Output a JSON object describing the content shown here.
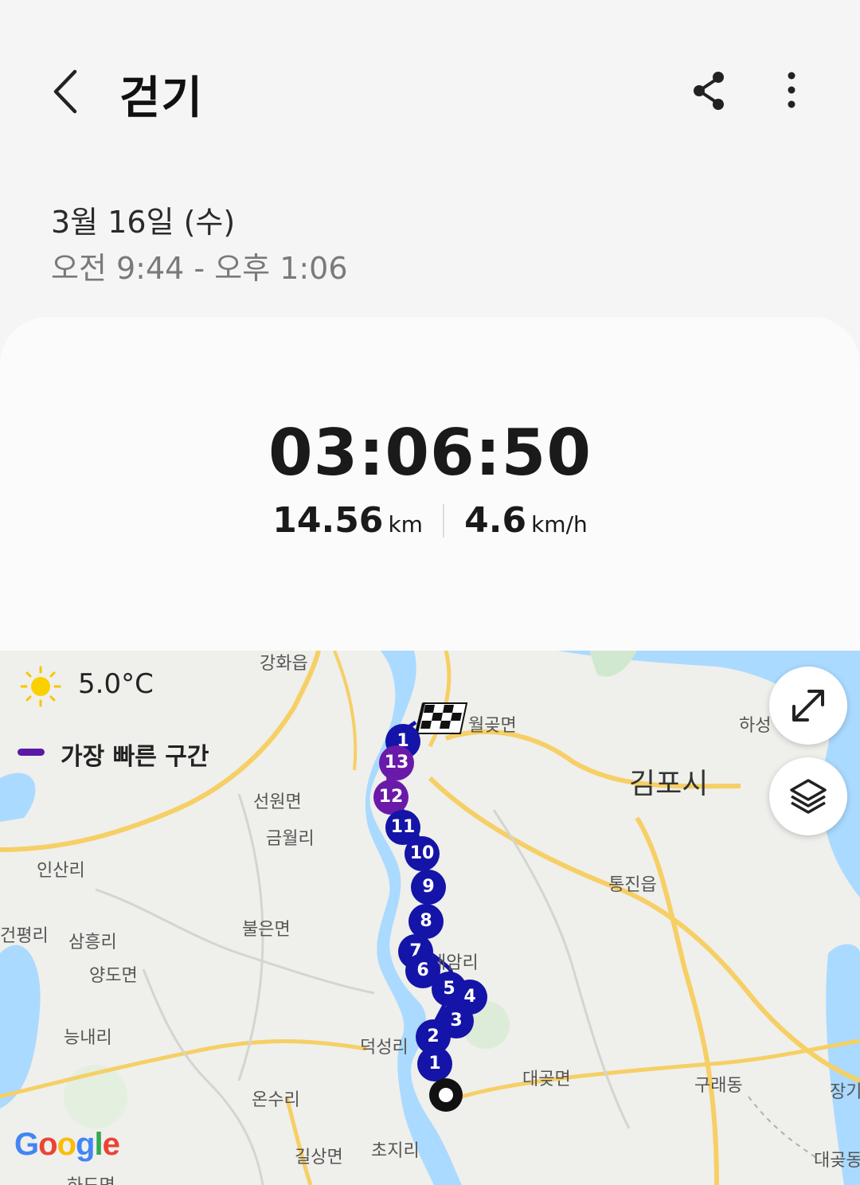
{
  "header": {
    "title": "걷기",
    "back_icon": "chevron-left-icon",
    "share_icon": "share-icon",
    "more_icon": "more-vertical-icon"
  },
  "session": {
    "date": "3월 16일 (수)",
    "time_range": "오전 9:44 - 오후 1:06"
  },
  "summary": {
    "duration": "03:06:50",
    "distance_value": "14.56",
    "distance_unit": "km",
    "speed_value": "4.6",
    "speed_unit": "km/h"
  },
  "map": {
    "weather": {
      "icon": "sun-icon",
      "temperature": "5.0°C"
    },
    "legend": {
      "label": "가장 빠른 구간",
      "color": "#5a1aa6"
    },
    "expand_icon": "expand-icon",
    "layers_icon": "layers-icon",
    "start_icon": "start-point-icon",
    "finish_icon": "checkered-flag-icon",
    "segment_markers": [
      "1",
      "2",
      "3",
      "4",
      "5",
      "6",
      "7",
      "8",
      "9",
      "10",
      "11",
      "12",
      "13",
      "1"
    ],
    "place_labels": [
      "강화읍",
      "월곶면",
      "하성",
      "김포시",
      "선원면",
      "금월리",
      "인산리",
      "통진읍",
      "불은면",
      "건평리",
      "삼흥리",
      "양도면",
      "내암리",
      "능내리",
      "덕성리",
      "대곶면",
      "구래동",
      "장기",
      "온수리",
      "길상면",
      "초지리",
      "대곶동",
      "하도면"
    ],
    "attribution": "Google",
    "colors": {
      "blue_marker": "#1414a8",
      "purple_marker": "#6a1aa8",
      "water": "#aadaff",
      "road": "#f6cf65"
    }
  }
}
